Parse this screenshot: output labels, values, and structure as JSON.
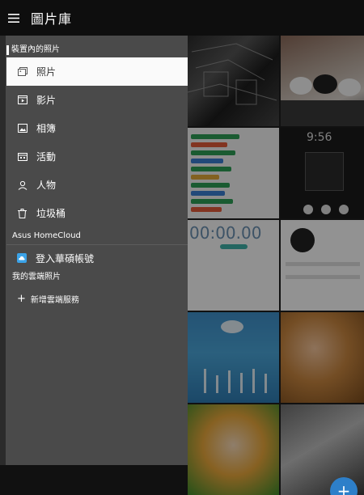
{
  "header": {
    "title": "圖片庫",
    "menu_icon": "hamburger-menu-icon"
  },
  "drawer": {
    "device_section_label": "裝置內的照片",
    "items": [
      {
        "label": "照片",
        "icon": "photos-icon",
        "selected": true
      },
      {
        "label": "影片",
        "icon": "video-icon",
        "selected": false
      },
      {
        "label": "相簿",
        "icon": "album-icon",
        "selected": false
      },
      {
        "label": "活動",
        "icon": "events-icon",
        "selected": false
      },
      {
        "label": "人物",
        "icon": "person-icon",
        "selected": false
      },
      {
        "label": "垃圾桶",
        "icon": "trash-icon",
        "selected": false
      }
    ],
    "homecloud_section_label": "Asus HomeCloud",
    "homecloud_item": {
      "label": "登入華碩帳號",
      "icon": "asus-cloud-icon"
    },
    "cloud_section_label": "我的雲端照片",
    "add_cloud_item": {
      "label": "新增雲端服務",
      "icon": "plus-icon"
    }
  },
  "gallery": {
    "clock_text": "00:00.00",
    "lock_time_text": "9:56",
    "fab_icon": "plus-icon"
  },
  "colors": {
    "drawer_bg": "#4a4a4a",
    "selected_bg": "#fafafa",
    "topbar_bg": "#0e0e0e",
    "accent": "#3ba3e8",
    "fab": "#2d7fc9"
  }
}
